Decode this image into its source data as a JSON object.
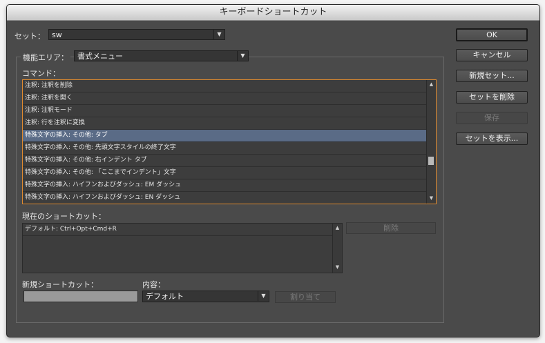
{
  "window": {
    "title": "キーボードショートカット"
  },
  "set": {
    "label": "セット：",
    "value": "sw"
  },
  "area": {
    "label": "機能エリア：",
    "value": "書式メニュー"
  },
  "commands": {
    "label": "コマンド：",
    "items": [
      "注釈: 注釈を削除",
      "注釈: 注釈を開く",
      "注釈: 注釈モード",
      "注釈: 行を注釈に変換",
      "特殊文字の挿入: その他: タブ",
      "特殊文字の挿入: その他: 先頭文字スタイルの終了文字",
      "特殊文字の挿入: その他: 右インデント タブ",
      "特殊文字の挿入: その他: 「ここまでインデント」文字",
      "特殊文字の挿入: ハイフンおよびダッシュ: EM ダッシュ",
      "特殊文字の挿入: ハイフンおよびダッシュ: EN ダッシュ"
    ],
    "selected_index": 4
  },
  "current_shortcuts": {
    "label": "現在のショートカット：",
    "items": [
      "デフォルト: Ctrl+Opt+Cmd+R"
    ],
    "remove_label": "削除"
  },
  "new_shortcut": {
    "label": "新規ショートカット：",
    "value": ""
  },
  "context": {
    "label": "内容：",
    "value": "デフォルト"
  },
  "assign_label": "割り当て",
  "buttons": {
    "ok": "OK",
    "cancel": "キャンセル",
    "new_set": "新規セット...",
    "delete_set": "セットを削除",
    "save": "保存",
    "show_set": "セットを表示..."
  },
  "icons": {
    "dropdown": "chevron-down-icon",
    "scroll_up": "scroll-up-icon",
    "scroll_down": "scroll-down-icon"
  }
}
